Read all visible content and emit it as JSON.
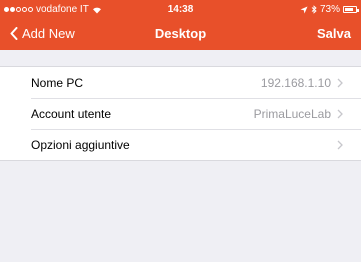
{
  "status_bar": {
    "carrier": "vodafone IT",
    "time": "14:38",
    "battery": "73%",
    "signal_bars_filled": 2,
    "signal_bars_total": 5,
    "icons": [
      "wifi-icon",
      "location-icon",
      "bluetooth-icon",
      "battery-icon"
    ]
  },
  "nav": {
    "back_label": "Add New",
    "title": "Desktop",
    "save_label": "Salva",
    "accent_color": "#e8502a"
  },
  "rows": [
    {
      "label": "Nome PC",
      "value": "192.168.1.10"
    },
    {
      "label": "Account utente",
      "value": "PrimaLuceLab"
    },
    {
      "label": "Opzioni aggiuntive",
      "value": ""
    }
  ]
}
